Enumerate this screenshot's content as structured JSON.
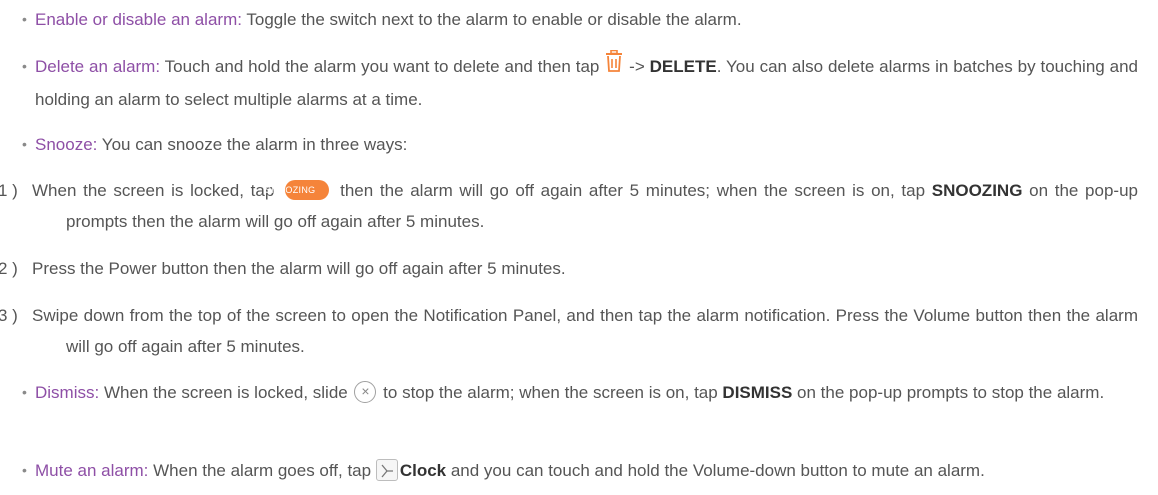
{
  "items": [
    {
      "term": "Enable or disable an alarm:",
      "text": " Toggle the switch next to the alarm to enable or disable the alarm."
    },
    {
      "term": "Delete an alarm:",
      "text_before": " Touch and hold the alarm you want to delete and then tap ",
      "text_arrow": " -> ",
      "bold": "DELETE",
      "text_after": ". You can also delete alarms in batches by touching and holding an alarm to select multiple alarms at a time.",
      "icon": "trash-icon"
    },
    {
      "term": "Snooze:",
      "text": " You can snooze the alarm in three ways:"
    },
    {
      "term": "Dismiss:",
      "text_before": " When the screen is locked, slide ",
      "text_middle": " to stop the alarm; when the screen is on, tap ",
      "bold": "DISMISS",
      "text_after": " on the pop-up prompts to stop the alarm.",
      "icon": "dismiss-x-icon"
    },
    {
      "term": "Mute an alarm:",
      "text_before": " When the alarm goes off, tap ",
      "bold": "Clock",
      "text_after": " and you can touch and hold the Volume-down button to mute an alarm.",
      "icon": "clock-app-icon"
    }
  ],
  "snooze_ways": [
    {
      "num": "1 ) ",
      "text_before": "When the screen is locked, tap ",
      "pill": "SNOOZING",
      "text_middle": " then the alarm will go off again after 5 minutes; when the screen is on, tap ",
      "bold": "SNOOZING",
      "text_after": " on the pop-up prompts then the alarm will go off again after 5 minutes."
    },
    {
      "num": "2 ) ",
      "text": "Press the Power button then the alarm will go off again after 5 minutes."
    },
    {
      "num": "3 ) ",
      "text": "Swipe down from the top of the screen to open the Notification Panel, and then tap the alarm notification. Press the Volume button then the alarm will go off again after 5 minutes."
    }
  ],
  "colors": {
    "term": "#8e4fa6",
    "accent": "#f5843a",
    "body_text": "#555555"
  }
}
